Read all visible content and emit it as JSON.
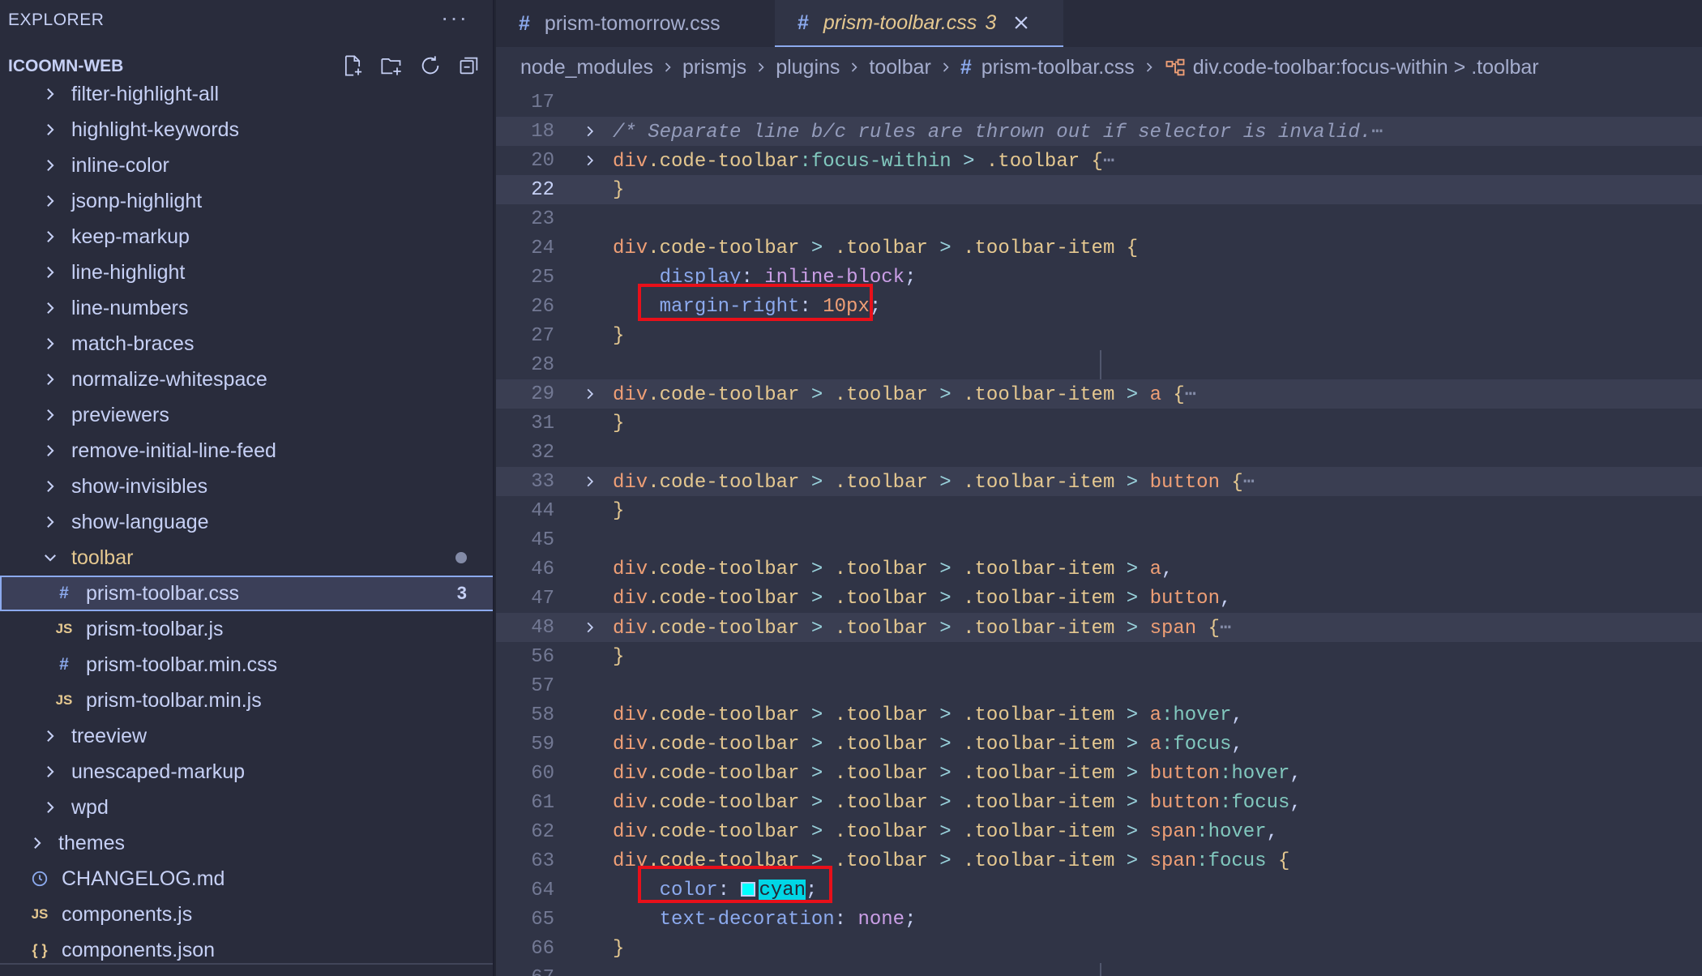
{
  "explorer": {
    "title": "EXPLORER",
    "more": "···",
    "workspace": "ICOOMN-WEB",
    "actions": [
      "new-file-icon",
      "new-folder-icon",
      "refresh-icon",
      "collapse-all-icon"
    ]
  },
  "tree": [
    {
      "label": "filter-highlight-all",
      "kind": "folder",
      "level": 1
    },
    {
      "label": "highlight-keywords",
      "kind": "folder",
      "level": 1
    },
    {
      "label": "inline-color",
      "kind": "folder",
      "level": 1
    },
    {
      "label": "jsonp-highlight",
      "kind": "folder",
      "level": 1
    },
    {
      "label": "keep-markup",
      "kind": "folder",
      "level": 1
    },
    {
      "label": "line-highlight",
      "kind": "folder",
      "level": 1
    },
    {
      "label": "line-numbers",
      "kind": "folder",
      "level": 1
    },
    {
      "label": "match-braces",
      "kind": "folder",
      "level": 1
    },
    {
      "label": "normalize-whitespace",
      "kind": "folder",
      "level": 1
    },
    {
      "label": "previewers",
      "kind": "folder",
      "level": 1
    },
    {
      "label": "remove-initial-line-feed",
      "kind": "folder",
      "level": 1
    },
    {
      "label": "show-invisibles",
      "kind": "folder",
      "level": 1
    },
    {
      "label": "show-language",
      "kind": "folder",
      "level": 1
    },
    {
      "label": "toolbar",
      "kind": "folder-open",
      "level": 1
    },
    {
      "label": "prism-toolbar.css",
      "kind": "css",
      "level": 2,
      "badge": "3"
    },
    {
      "label": "prism-toolbar.js",
      "kind": "js",
      "level": 2
    },
    {
      "label": "prism-toolbar.min.css",
      "kind": "css",
      "level": 2
    },
    {
      "label": "prism-toolbar.min.js",
      "kind": "js",
      "level": 2
    },
    {
      "label": "treeview",
      "kind": "folder",
      "level": 1
    },
    {
      "label": "unescaped-markup",
      "kind": "folder",
      "level": 1
    },
    {
      "label": "wpd",
      "kind": "folder",
      "level": 1
    },
    {
      "label": "themes",
      "kind": "folder",
      "level": 0
    },
    {
      "label": "CHANGELOG.md",
      "kind": "md",
      "level": 0
    },
    {
      "label": "components.js",
      "kind": "js",
      "level": 0
    },
    {
      "label": "components.json",
      "kind": "json",
      "level": 0
    }
  ],
  "tabs": [
    {
      "label": "prism-tomorrow.css",
      "active": false
    },
    {
      "label": "prism-toolbar.css",
      "active": true,
      "problems": "3"
    }
  ],
  "breadcrumb": [
    "node_modules",
    "prismjs",
    "plugins",
    "toolbar",
    "prism-toolbar.css",
    "div.code-toolbar:focus-within > .toolbar"
  ],
  "code": [
    {
      "n": "17",
      "toks": []
    },
    {
      "n": "18",
      "fold": true,
      "hl": true,
      "toks": [
        [
          "cm",
          "/* Separate line b/c rules are thrown out if selector is invalid."
        ],
        [
          "ell",
          "⋯"
        ]
      ]
    },
    {
      "n": "20",
      "fold": true,
      "toks": [
        [
          "tag",
          "div"
        ],
        [
          "cls",
          ".code-toolbar"
        ],
        [
          "pc",
          ":focus-within"
        ],
        [
          "op",
          " > "
        ],
        [
          "cls",
          ".toolbar"
        ],
        [
          "br",
          " {"
        ],
        [
          "ell",
          "⋯"
        ]
      ]
    },
    {
      "n": "22",
      "cur": true,
      "toks": [
        [
          "br",
          "}"
        ]
      ]
    },
    {
      "n": "23",
      "toks": []
    },
    {
      "n": "24",
      "toks": [
        [
          "tag",
          "div"
        ],
        [
          "cls",
          ".code-toolbar"
        ],
        [
          "op",
          " > "
        ],
        [
          "cls",
          ".toolbar"
        ],
        [
          "op",
          " > "
        ],
        [
          "cls",
          ".toolbar-item"
        ],
        [
          "br",
          " {"
        ]
      ]
    },
    {
      "n": "25",
      "toks": [
        [
          "plain",
          "    "
        ],
        [
          "prop",
          "display"
        ],
        [
          "plain",
          ": "
        ],
        [
          "val",
          "inline-block"
        ],
        [
          "plain",
          ";"
        ]
      ]
    },
    {
      "n": "26",
      "toks": [
        [
          "plain",
          "    "
        ],
        [
          "prop",
          "margin-right"
        ],
        [
          "plain",
          ": "
        ],
        [
          "num",
          "10px"
        ],
        [
          "plain",
          ";"
        ]
      ]
    },
    {
      "n": "27",
      "toks": [
        [
          "br",
          "}"
        ]
      ]
    },
    {
      "n": "28",
      "toks": []
    },
    {
      "n": "29",
      "fold": true,
      "hl": true,
      "toks": [
        [
          "tag",
          "div"
        ],
        [
          "cls",
          ".code-toolbar"
        ],
        [
          "op",
          " > "
        ],
        [
          "cls",
          ".toolbar"
        ],
        [
          "op",
          " > "
        ],
        [
          "cls",
          ".toolbar-item"
        ],
        [
          "op",
          " > "
        ],
        [
          "tag",
          "a"
        ],
        [
          "br",
          " {"
        ],
        [
          "ell",
          "⋯"
        ]
      ]
    },
    {
      "n": "31",
      "toks": [
        [
          "br",
          "}"
        ]
      ]
    },
    {
      "n": "32",
      "toks": []
    },
    {
      "n": "33",
      "fold": true,
      "hl": true,
      "toks": [
        [
          "tag",
          "div"
        ],
        [
          "cls",
          ".code-toolbar"
        ],
        [
          "op",
          " > "
        ],
        [
          "cls",
          ".toolbar"
        ],
        [
          "op",
          " > "
        ],
        [
          "cls",
          ".toolbar-item"
        ],
        [
          "op",
          " > "
        ],
        [
          "tag",
          "button"
        ],
        [
          "br",
          " {"
        ],
        [
          "ell",
          "⋯"
        ]
      ]
    },
    {
      "n": "44",
      "toks": [
        [
          "br",
          "}"
        ]
      ]
    },
    {
      "n": "45",
      "toks": []
    },
    {
      "n": "46",
      "toks": [
        [
          "tag",
          "div"
        ],
        [
          "cls",
          ".code-toolbar"
        ],
        [
          "op",
          " > "
        ],
        [
          "cls",
          ".toolbar"
        ],
        [
          "op",
          " > "
        ],
        [
          "cls",
          ".toolbar-item"
        ],
        [
          "op",
          " > "
        ],
        [
          "tag",
          "a"
        ],
        [
          "plain",
          ","
        ]
      ]
    },
    {
      "n": "47",
      "toks": [
        [
          "tag",
          "div"
        ],
        [
          "cls",
          ".code-toolbar"
        ],
        [
          "op",
          " > "
        ],
        [
          "cls",
          ".toolbar"
        ],
        [
          "op",
          " > "
        ],
        [
          "cls",
          ".toolbar-item"
        ],
        [
          "op",
          " > "
        ],
        [
          "tag",
          "button"
        ],
        [
          "plain",
          ","
        ]
      ]
    },
    {
      "n": "48",
      "fold": true,
      "hl": true,
      "toks": [
        [
          "tag",
          "div"
        ],
        [
          "cls",
          ".code-toolbar"
        ],
        [
          "op",
          " > "
        ],
        [
          "cls",
          ".toolbar"
        ],
        [
          "op",
          " > "
        ],
        [
          "cls",
          ".toolbar-item"
        ],
        [
          "op",
          " > "
        ],
        [
          "tag",
          "span"
        ],
        [
          "br",
          " {"
        ],
        [
          "ell",
          "⋯"
        ]
      ]
    },
    {
      "n": "56",
      "toks": [
        [
          "br",
          "}"
        ]
      ]
    },
    {
      "n": "57",
      "toks": []
    },
    {
      "n": "58",
      "toks": [
        [
          "tag",
          "div"
        ],
        [
          "cls",
          ".code-toolbar"
        ],
        [
          "op",
          " > "
        ],
        [
          "cls",
          ".toolbar"
        ],
        [
          "op",
          " > "
        ],
        [
          "cls",
          ".toolbar-item"
        ],
        [
          "op",
          " > "
        ],
        [
          "tag",
          "a"
        ],
        [
          "pc",
          ":hover"
        ],
        [
          "plain",
          ","
        ]
      ]
    },
    {
      "n": "59",
      "toks": [
        [
          "tag",
          "div"
        ],
        [
          "cls",
          ".code-toolbar"
        ],
        [
          "op",
          " > "
        ],
        [
          "cls",
          ".toolbar"
        ],
        [
          "op",
          " > "
        ],
        [
          "cls",
          ".toolbar-item"
        ],
        [
          "op",
          " > "
        ],
        [
          "tag",
          "a"
        ],
        [
          "pc",
          ":focus"
        ],
        [
          "plain",
          ","
        ]
      ]
    },
    {
      "n": "60",
      "toks": [
        [
          "tag",
          "div"
        ],
        [
          "cls",
          ".code-toolbar"
        ],
        [
          "op",
          " > "
        ],
        [
          "cls",
          ".toolbar"
        ],
        [
          "op",
          " > "
        ],
        [
          "cls",
          ".toolbar-item"
        ],
        [
          "op",
          " > "
        ],
        [
          "tag",
          "button"
        ],
        [
          "pc",
          ":hover"
        ],
        [
          "plain",
          ","
        ]
      ]
    },
    {
      "n": "61",
      "toks": [
        [
          "tag",
          "div"
        ],
        [
          "cls",
          ".code-toolbar"
        ],
        [
          "op",
          " > "
        ],
        [
          "cls",
          ".toolbar"
        ],
        [
          "op",
          " > "
        ],
        [
          "cls",
          ".toolbar-item"
        ],
        [
          "op",
          " > "
        ],
        [
          "tag",
          "button"
        ],
        [
          "pc",
          ":focus"
        ],
        [
          "plain",
          ","
        ]
      ]
    },
    {
      "n": "62",
      "toks": [
        [
          "tag",
          "div"
        ],
        [
          "cls",
          ".code-toolbar"
        ],
        [
          "op",
          " > "
        ],
        [
          "cls",
          ".toolbar"
        ],
        [
          "op",
          " > "
        ],
        [
          "cls",
          ".toolbar-item"
        ],
        [
          "op",
          " > "
        ],
        [
          "tag",
          "span"
        ],
        [
          "pc",
          ":hover"
        ],
        [
          "plain",
          ","
        ]
      ]
    },
    {
      "n": "63",
      "toks": [
        [
          "tag",
          "div"
        ],
        [
          "cls",
          ".code-toolbar"
        ],
        [
          "op",
          " > "
        ],
        [
          "cls",
          ".toolbar"
        ],
        [
          "op",
          " > "
        ],
        [
          "cls",
          ".toolbar-item"
        ],
        [
          "op",
          " > "
        ],
        [
          "tag",
          "span"
        ],
        [
          "pc",
          ":focus"
        ],
        [
          "br",
          " {"
        ]
      ]
    },
    {
      "n": "64",
      "toks": [
        [
          "plain",
          "    "
        ],
        [
          "prop",
          "color"
        ],
        [
          "plain",
          ": "
        ],
        [
          "swatch",
          ""
        ],
        [
          "cyan",
          "cyan"
        ],
        [
          "plain",
          ";"
        ]
      ]
    },
    {
      "n": "65",
      "toks": [
        [
          "plain",
          "    "
        ],
        [
          "prop",
          "text-decoration"
        ],
        [
          "plain",
          ": "
        ],
        [
          "val",
          "none"
        ],
        [
          "plain",
          ";"
        ]
      ]
    },
    {
      "n": "66",
      "toks": [
        [
          "br",
          "}"
        ]
      ]
    },
    {
      "n": "67",
      "toks": []
    }
  ],
  "colors": {
    "annotation_box": "#e8101a",
    "color_swatch": "#00ffff"
  }
}
